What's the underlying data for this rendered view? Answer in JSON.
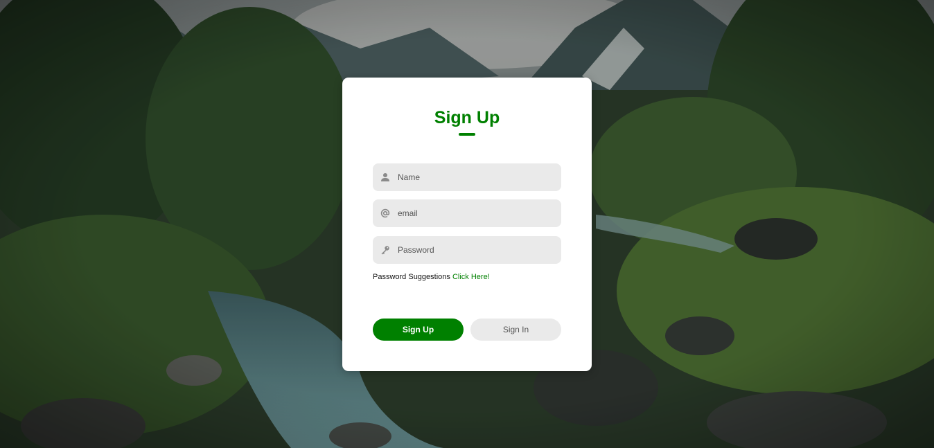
{
  "form": {
    "title": "Sign Up",
    "name_placeholder": "Name",
    "email_placeholder": "email",
    "password_placeholder": "Password",
    "suggestion_text": "Password Suggestions",
    "suggestion_link": "Click Here!",
    "signup_label": "Sign Up",
    "signin_label": "Sign In"
  },
  "icons": {
    "name": "user-icon",
    "email": "at-sign-icon",
    "password": "key-icon"
  },
  "colors": {
    "accent": "#008000",
    "field_bg": "#eaeaea",
    "card_bg": "#ffffff",
    "secondary_button": "#eaeaea"
  }
}
